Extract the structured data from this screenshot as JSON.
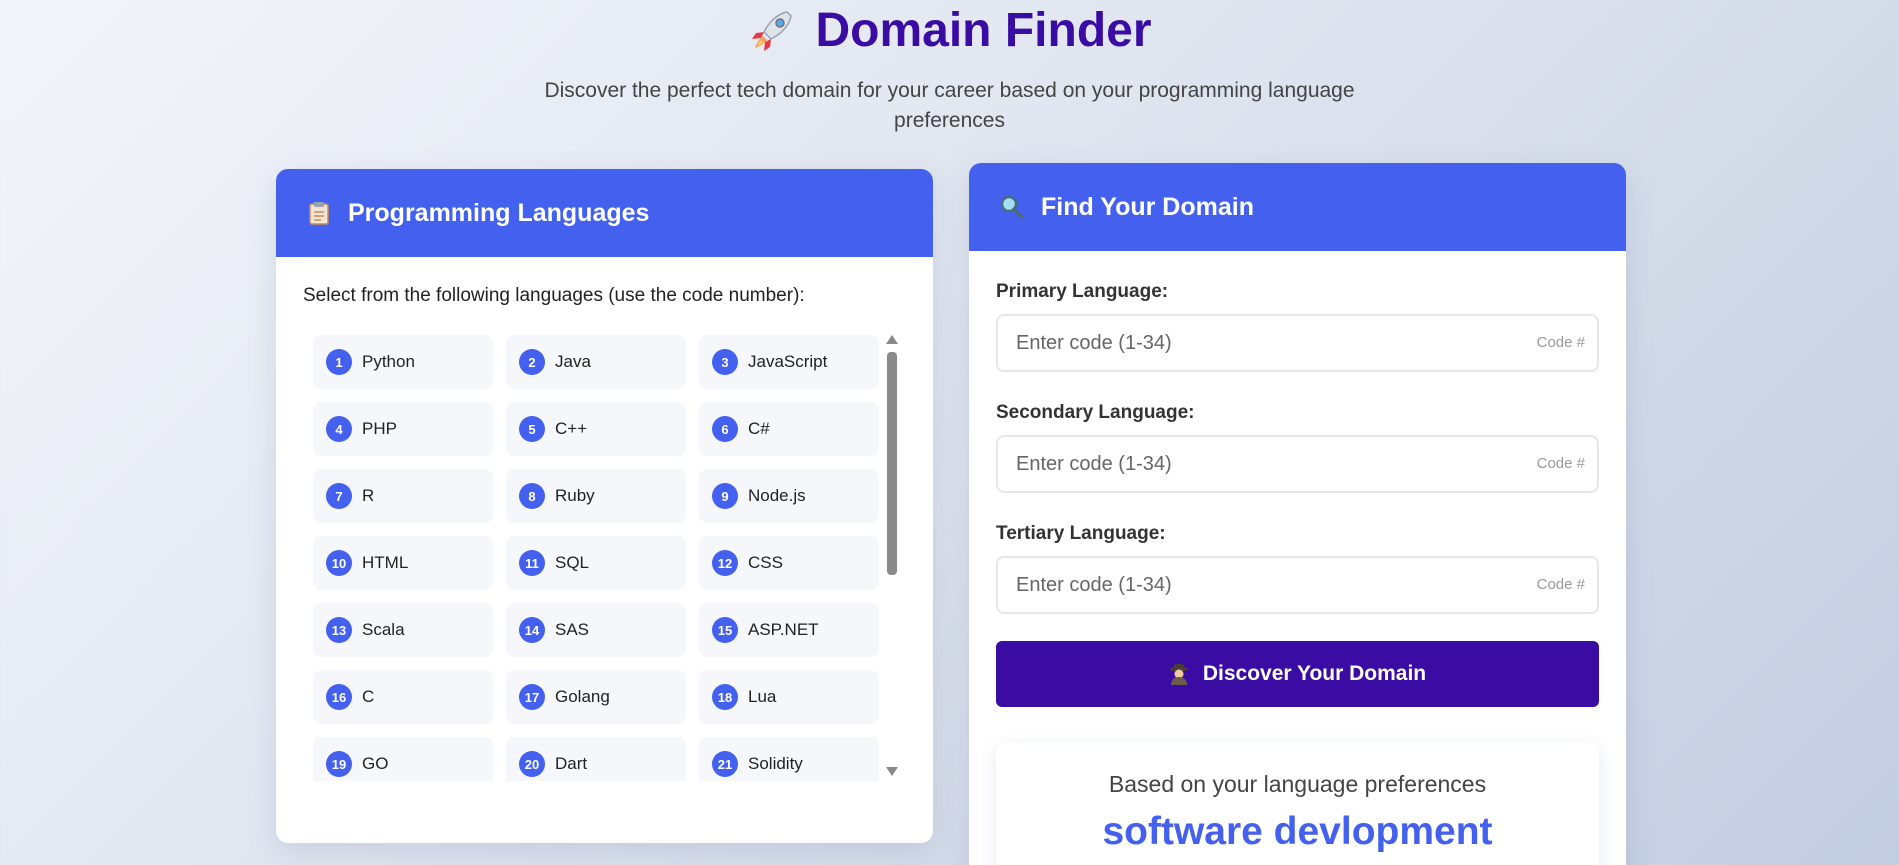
{
  "header": {
    "title": "Domain Finder",
    "title_icon": "rocket-icon",
    "subtitle": "Discover the perfect tech domain for your career based on your programming language preferences"
  },
  "languages_panel": {
    "title": "Programming Languages",
    "icon": "clipboard-icon",
    "intro": "Select from the following languages (use the code number):",
    "items": [
      {
        "code": "1",
        "name": "Python"
      },
      {
        "code": "2",
        "name": "Java"
      },
      {
        "code": "3",
        "name": "JavaScript"
      },
      {
        "code": "4",
        "name": "PHP"
      },
      {
        "code": "5",
        "name": "C++"
      },
      {
        "code": "6",
        "name": "C#"
      },
      {
        "code": "7",
        "name": "R"
      },
      {
        "code": "8",
        "name": "Ruby"
      },
      {
        "code": "9",
        "name": "Node.js"
      },
      {
        "code": "10",
        "name": "HTML"
      },
      {
        "code": "11",
        "name": "SQL"
      },
      {
        "code": "12",
        "name": "CSS"
      },
      {
        "code": "13",
        "name": "Scala"
      },
      {
        "code": "14",
        "name": "SAS"
      },
      {
        "code": "15",
        "name": "ASP.NET"
      },
      {
        "code": "16",
        "name": "C"
      },
      {
        "code": "17",
        "name": "Golang"
      },
      {
        "code": "18",
        "name": "Lua"
      },
      {
        "code": "19",
        "name": "GO"
      },
      {
        "code": "20",
        "name": "Dart"
      },
      {
        "code": "21",
        "name": "Solidity"
      }
    ]
  },
  "finder_panel": {
    "title": "Find Your Domain",
    "icon": "magnifier-icon",
    "fields": [
      {
        "label": "Primary Language:",
        "placeholder": "Enter code (1-34)",
        "value": "",
        "hint": "Code #"
      },
      {
        "label": "Secondary Language:",
        "placeholder": "Enter code (1-34)",
        "value": "",
        "hint": "Code #"
      },
      {
        "label": "Tertiary Language:",
        "placeholder": "Enter code (1-34)",
        "value": "",
        "hint": "Code #"
      }
    ],
    "button_label": "Discover Your Domain",
    "button_icon": "detective-icon",
    "result": {
      "caption": "Based on your language preferences",
      "domain": "software devlopment"
    }
  },
  "colors": {
    "accent": "#4361ee",
    "title": "#3a0ca3",
    "button": "#3a0ca3"
  }
}
